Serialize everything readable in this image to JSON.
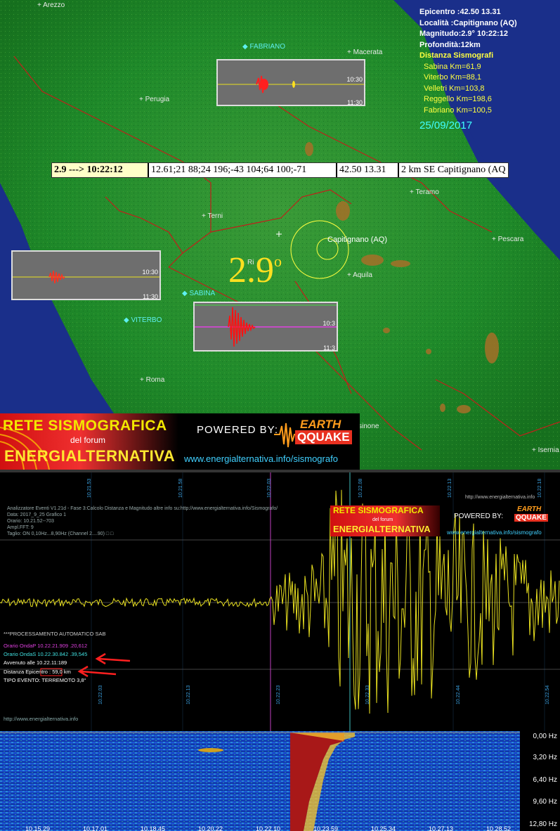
{
  "map": {
    "cities": [
      {
        "name": "Arezzo",
        "station": false
      },
      {
        "name": "FABRIANO",
        "station": true
      },
      {
        "name": "Macerata",
        "station": false
      },
      {
        "name": "Perugia",
        "station": false
      },
      {
        "name": "Teramo",
        "station": false
      },
      {
        "name": "Terni",
        "station": false
      },
      {
        "name": "Pescara",
        "station": false
      },
      {
        "name": "Capitignano (AQ)",
        "station": false
      },
      {
        "name": "Aquila",
        "station": false
      },
      {
        "name": "Ri",
        "station": false
      },
      {
        "name": "SABINA",
        "station": true
      },
      {
        "name": "VITERBO",
        "station": true
      },
      {
        "name": "Roma",
        "station": false
      },
      {
        "name": "sinone",
        "station": false
      },
      {
        "name": "Isernia",
        "station": false
      }
    ],
    "info": {
      "epicentro": "Epicentro :42.50 13.31",
      "localita": "Località :Capitignano (AQ)",
      "magnitudo": "Magnitudo:2.9°  10:22:12",
      "profondita": "Profondità:12km",
      "distanza_title": "Distanza Sismografi",
      "distances": [
        "Sabina Km=61,9",
        "Viterbo Km=88,1",
        "Velletri Km=103,8",
        "Reggello Km=198,6",
        "Fabriano Km=100,5"
      ],
      "date": "25/09/2017"
    },
    "event_bar": {
      "c1": "2.9 ---> 10:22:12",
      "c2": "12.61;21 88;24 196;-43 104;64 100;-71",
      "c3": "42.50 13.31",
      "c4": "2 km SE Capitignano (AQ"
    },
    "magnitude": "2.9",
    "magnitude_deg": "o",
    "mini_time_top": "10:30",
    "mini_time_bottom": "11:30",
    "mini_time_top_short": "10:3",
    "mini_time_bottom_short": "11:3"
  },
  "banner": {
    "rete": "RETE SISMOGRAFICA",
    "forum": "del forum",
    "energ": "ENERGIALTERNATIVA",
    "powered": "POWERED BY:",
    "earth": "EARTH",
    "quake": "QQUAKE",
    "url": "www.energialternativa.info/sismografo"
  },
  "seismogram": {
    "header_lines": [
      "Analizzatore Eventi V1.21d - Fase 3:Calcolo Distanza e Magnitudo altre info su:http://www.energialternativa.info/Sismografo/",
      "Data: 2017_9_25 Grafico 1",
      "Orario: 10.21.52--703",
      "Ampl.FFT: 9",
      "Taglio: ON 0,10Hz...8,90Hz     (Channel 2....90) □ □"
    ],
    "top_url": "http://www.energialternativa.info",
    "top_times": [
      "10.21.53",
      "10.21.58",
      "10.22.03",
      "10.22.08",
      "10.22.13",
      "10.22.18"
    ],
    "bottom_times": [
      "10.22.03",
      "10.22.13",
      "10.22.23",
      "10.22.33",
      "10.22.44",
      "10.22.54"
    ],
    "auto_title": "***PROCESSAMENTO AUTOMATICO SAB",
    "onda_p": "Orario OndaP 10.22.21.909 .20,612",
    "onda_s": "Orario OndaS 10.22.30.842 .39,545",
    "avvenuto": "Avvenuto alle 10.22.11:189",
    "distanza_label": "Distanza Epicentro :",
    "distanza_value": "59,0 km",
    "tipo": "TIPO EVENTO: TERREMOTO 3,8°",
    "bottom_url": "http://www.energialternativa.info",
    "mini_banner_url": "www.energialternativa.info/sismografo",
    "mini_banner_top_url": "http://www.energialternativa.info"
  },
  "spectrogram": {
    "freq_labels": [
      "0,00 Hz",
      "3,20 Hz",
      "6,40 Hz",
      "9,60 Hz",
      "12,80 Hz"
    ],
    "time_labels": [
      "10.15.29",
      "10.17.01",
      "10.18.45",
      "10.20.22",
      "10.22.10",
      "10.23.59",
      "10.25.34",
      "10.27.13",
      "10.28.52"
    ]
  },
  "colors": {
    "accent_yellow": "#ffe020",
    "station_cyan": "#5ef0f0",
    "trace_yellow": "#e8e020",
    "onda_p_magenta": "#e040e0",
    "onda_s_cyan": "#40e0e0",
    "arrow_red": "#ff2020"
  }
}
